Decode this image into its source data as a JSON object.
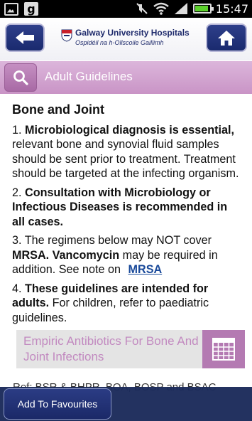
{
  "status_bar": {
    "time": "15:47",
    "icons": [
      "gallery-icon",
      "g-app-icon",
      "mute-icon",
      "wifi-icon",
      "signal-icon",
      "battery-icon"
    ]
  },
  "header": {
    "logo_title": "Galway University Hospitals",
    "logo_subtitle": "Ospidéil na h-Ollscoile Gaillimh",
    "back_icon": "back-arrow-icon",
    "home_icon": "home-icon"
  },
  "title_bar": {
    "title": "Adult Guidelines",
    "search_icon": "search-icon"
  },
  "content": {
    "section_title": "Bone and Joint",
    "p1": {
      "num": "1. ",
      "bold": "Microbiological diagnosis is essential,",
      "rest": " relevant bone and synovial fluid samples should be sent prior to treatment. Treatment should be targeted at the infecting organism."
    },
    "p2": {
      "num": "2. ",
      "bold": "Consultation with Microbiology or Infectious Diseases is recommended in all cases."
    },
    "p3": {
      "pre": "3. The regimens below may NOT cover ",
      "bold1": "MRSA. Vancomycin",
      "mid": " may be required in addition. See note on ",
      "link": "MRSA"
    },
    "p4": {
      "num": "4. ",
      "bold": "These guidelines are intended for adults.",
      "rest": " For children, refer to paediatric guidelines."
    },
    "antibiotics_link": "Empiric Antibiotics For Bone And Joint Infections",
    "partial_ref": "Ref: BSR & BHPR, BOA, BOSP and BSAC"
  },
  "bottom_bar": {
    "favourites_label": "Add To Favourites"
  },
  "colors": {
    "navy": "#1a2a6e",
    "purple_bar": "#c994c6",
    "link": "#1a4a9a",
    "antibiotics_text": "#c28ac0",
    "calendar_bg": "#b47ab2"
  }
}
